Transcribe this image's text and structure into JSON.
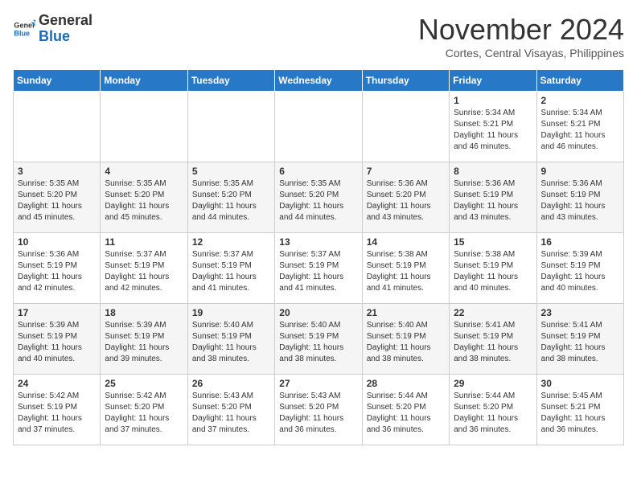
{
  "header": {
    "logo_general": "General",
    "logo_blue": "Blue",
    "month": "November 2024",
    "location": "Cortes, Central Visayas, Philippines"
  },
  "days_of_week": [
    "Sunday",
    "Monday",
    "Tuesday",
    "Wednesday",
    "Thursday",
    "Friday",
    "Saturday"
  ],
  "weeks": [
    [
      {
        "day": "",
        "info": ""
      },
      {
        "day": "",
        "info": ""
      },
      {
        "day": "",
        "info": ""
      },
      {
        "day": "",
        "info": ""
      },
      {
        "day": "",
        "info": ""
      },
      {
        "day": "1",
        "info": "Sunrise: 5:34 AM\nSunset: 5:21 PM\nDaylight: 11 hours\nand 46 minutes."
      },
      {
        "day": "2",
        "info": "Sunrise: 5:34 AM\nSunset: 5:21 PM\nDaylight: 11 hours\nand 46 minutes."
      }
    ],
    [
      {
        "day": "3",
        "info": "Sunrise: 5:35 AM\nSunset: 5:20 PM\nDaylight: 11 hours\nand 45 minutes."
      },
      {
        "day": "4",
        "info": "Sunrise: 5:35 AM\nSunset: 5:20 PM\nDaylight: 11 hours\nand 45 minutes."
      },
      {
        "day": "5",
        "info": "Sunrise: 5:35 AM\nSunset: 5:20 PM\nDaylight: 11 hours\nand 44 minutes."
      },
      {
        "day": "6",
        "info": "Sunrise: 5:35 AM\nSunset: 5:20 PM\nDaylight: 11 hours\nand 44 minutes."
      },
      {
        "day": "7",
        "info": "Sunrise: 5:36 AM\nSunset: 5:20 PM\nDaylight: 11 hours\nand 43 minutes."
      },
      {
        "day": "8",
        "info": "Sunrise: 5:36 AM\nSunset: 5:19 PM\nDaylight: 11 hours\nand 43 minutes."
      },
      {
        "day": "9",
        "info": "Sunrise: 5:36 AM\nSunset: 5:19 PM\nDaylight: 11 hours\nand 43 minutes."
      }
    ],
    [
      {
        "day": "10",
        "info": "Sunrise: 5:36 AM\nSunset: 5:19 PM\nDaylight: 11 hours\nand 42 minutes."
      },
      {
        "day": "11",
        "info": "Sunrise: 5:37 AM\nSunset: 5:19 PM\nDaylight: 11 hours\nand 42 minutes."
      },
      {
        "day": "12",
        "info": "Sunrise: 5:37 AM\nSunset: 5:19 PM\nDaylight: 11 hours\nand 41 minutes."
      },
      {
        "day": "13",
        "info": "Sunrise: 5:37 AM\nSunset: 5:19 PM\nDaylight: 11 hours\nand 41 minutes."
      },
      {
        "day": "14",
        "info": "Sunrise: 5:38 AM\nSunset: 5:19 PM\nDaylight: 11 hours\nand 41 minutes."
      },
      {
        "day": "15",
        "info": "Sunrise: 5:38 AM\nSunset: 5:19 PM\nDaylight: 11 hours\nand 40 minutes."
      },
      {
        "day": "16",
        "info": "Sunrise: 5:39 AM\nSunset: 5:19 PM\nDaylight: 11 hours\nand 40 minutes."
      }
    ],
    [
      {
        "day": "17",
        "info": "Sunrise: 5:39 AM\nSunset: 5:19 PM\nDaylight: 11 hours\nand 40 minutes."
      },
      {
        "day": "18",
        "info": "Sunrise: 5:39 AM\nSunset: 5:19 PM\nDaylight: 11 hours\nand 39 minutes."
      },
      {
        "day": "19",
        "info": "Sunrise: 5:40 AM\nSunset: 5:19 PM\nDaylight: 11 hours\nand 38 minutes."
      },
      {
        "day": "20",
        "info": "Sunrise: 5:40 AM\nSunset: 5:19 PM\nDaylight: 11 hours\nand 38 minutes."
      },
      {
        "day": "21",
        "info": "Sunrise: 5:40 AM\nSunset: 5:19 PM\nDaylight: 11 hours\nand 38 minutes."
      },
      {
        "day": "22",
        "info": "Sunrise: 5:41 AM\nSunset: 5:19 PM\nDaylight: 11 hours\nand 38 minutes."
      },
      {
        "day": "23",
        "info": "Sunrise: 5:41 AM\nSunset: 5:19 PM\nDaylight: 11 hours\nand 38 minutes."
      }
    ],
    [
      {
        "day": "24",
        "info": "Sunrise: 5:42 AM\nSunset: 5:19 PM\nDaylight: 11 hours\nand 37 minutes."
      },
      {
        "day": "25",
        "info": "Sunrise: 5:42 AM\nSunset: 5:20 PM\nDaylight: 11 hours\nand 37 minutes."
      },
      {
        "day": "26",
        "info": "Sunrise: 5:43 AM\nSunset: 5:20 PM\nDaylight: 11 hours\nand 37 minutes."
      },
      {
        "day": "27",
        "info": "Sunrise: 5:43 AM\nSunset: 5:20 PM\nDaylight: 11 hours\nand 36 minutes."
      },
      {
        "day": "28",
        "info": "Sunrise: 5:44 AM\nSunset: 5:20 PM\nDaylight: 11 hours\nand 36 minutes."
      },
      {
        "day": "29",
        "info": "Sunrise: 5:44 AM\nSunset: 5:20 PM\nDaylight: 11 hours\nand 36 minutes."
      },
      {
        "day": "30",
        "info": "Sunrise: 5:45 AM\nSunset: 5:21 PM\nDaylight: 11 hours\nand 36 minutes."
      }
    ]
  ]
}
